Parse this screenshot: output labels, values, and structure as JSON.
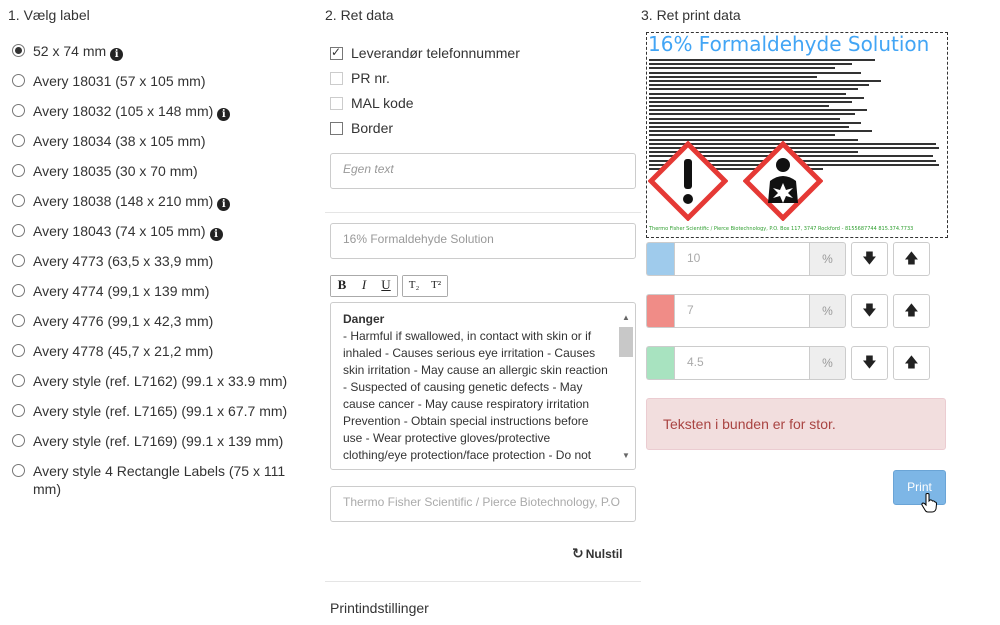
{
  "col1": {
    "heading": "1. Vælg label",
    "options": [
      {
        "label": "52 x 74 mm",
        "selected": true,
        "info": true
      },
      {
        "label": "Avery 18031 (57 x 105 mm)",
        "selected": false,
        "info": false
      },
      {
        "label": "Avery 18032 (105 x 148 mm)",
        "selected": false,
        "info": true
      },
      {
        "label": "Avery 18034 (38 x 105 mm)",
        "selected": false,
        "info": false
      },
      {
        "label": "Avery 18035 (30 x 70 mm)",
        "selected": false,
        "info": false
      },
      {
        "label": "Avery 18038 (148 x 210 mm)",
        "selected": false,
        "info": true
      },
      {
        "label": "Avery 18043 (74 x 105 mm)",
        "selected": false,
        "info": true
      },
      {
        "label": "Avery 4773 (63,5 x 33,9 mm)",
        "selected": false,
        "info": false
      },
      {
        "label": "Avery 4774 (99,1 x 139 mm)",
        "selected": false,
        "info": false
      },
      {
        "label": "Avery 4776 (99,1 x 42,3 mm)",
        "selected": false,
        "info": false
      },
      {
        "label": "Avery 4778 (45,7 x 21,2 mm)",
        "selected": false,
        "info": false
      },
      {
        "label": "Avery style (ref. L7162) (99.1 x 33.9 mm)",
        "selected": false,
        "info": false
      },
      {
        "label": "Avery style (ref. L7165) (99.1 x 67.7 mm)",
        "selected": false,
        "info": false
      },
      {
        "label": "Avery style (ref. L7169) (99.1 x 139 mm)",
        "selected": false,
        "info": false
      },
      {
        "label": "Avery style 4 Rectangle Labels (75 x 111 mm)",
        "selected": false,
        "info": false
      }
    ]
  },
  "col2": {
    "heading": "2. Ret data",
    "checks": [
      {
        "label": "Leverandør telefonnummer",
        "checked": true,
        "disabled": false
      },
      {
        "label": "PR nr.",
        "checked": false,
        "disabled": true
      },
      {
        "label": "MAL kode",
        "checked": false,
        "disabled": true
      },
      {
        "label": "Border",
        "checked": false,
        "disabled": false
      }
    ],
    "custom_text_placeholder": "Egen text",
    "title_value": "16% Formaldehyde Solution",
    "toolbar": {
      "bold": "B",
      "italic": "I",
      "underline": "U",
      "subscript": "T₂",
      "superscript": "T²"
    },
    "text_heading": "Danger",
    "text_body": "- Harmful if swallowed, in contact with skin or if inhaled - Causes serious eye irritation - Causes skin irritation - May cause an allergic skin reaction - Suspected of causing genetic defects - May cause cancer - May cause respiratory irritation Prevention - Obtain special instructions before use - Wear protective gloves/protective clothing/eye protection/face protection - Do not",
    "supplier_value": "Thermo Fisher Scientific / Pierce Biotechnology, P.O",
    "reset_label": "Nulstil",
    "print_settings_label": "Printindstillinger"
  },
  "col3": {
    "heading": "3. Ret print data",
    "preview_title": "16% Formaldehyde Solution",
    "preview_footer": "Thermo Fisher Scientific / Pierce Biotechnology, P.O. Box 117, 3747 Rockford - 8155687744 815.374.7733",
    "sizes": [
      {
        "color": "#9fcbec",
        "value": "10",
        "unit": "%"
      },
      {
        "color": "#f08c87",
        "value": "7",
        "unit": "%"
      },
      {
        "color": "#a8e3c0",
        "value": "4.5",
        "unit": "%"
      }
    ],
    "arrow_down": "🡇",
    "arrow_up": "🡅",
    "alert_text": "Teksten i bunden er for stor.",
    "print_label": "Print"
  }
}
